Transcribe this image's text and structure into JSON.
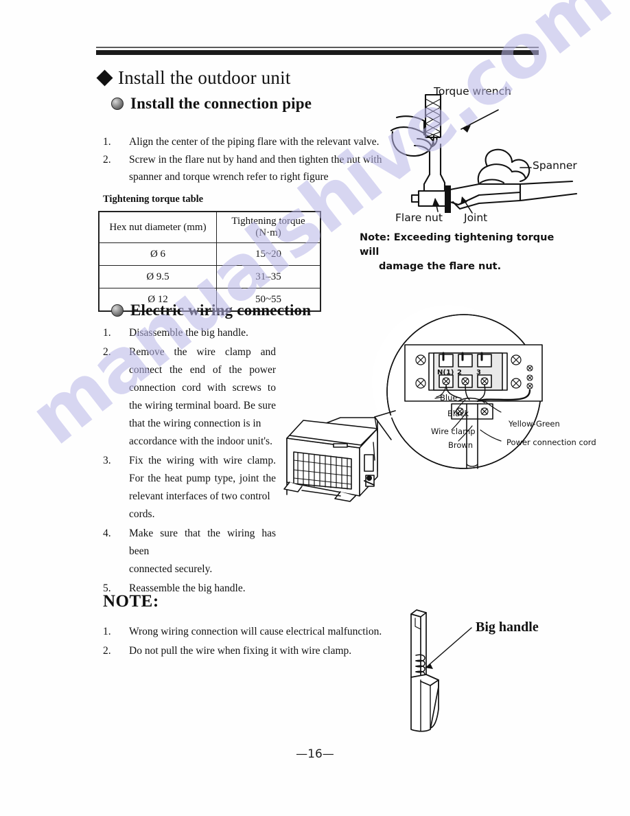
{
  "document": {
    "page_number": "—16—",
    "watermark": "manualshive.com"
  },
  "section_heading": "Install the outdoor unit",
  "subsection_pipe": {
    "title": "Install the connection pipe",
    "steps": [
      {
        "num": "1.",
        "text": "Align the center of the piping flare with the relevant valve."
      },
      {
        "num": "2.",
        "text": "Screw in the flare nut by hand and then tighten the nut with",
        "text2": "spanner and torque wrench refer to right figure"
      }
    ]
  },
  "torque_table": {
    "caption": "Tightening torque table",
    "headers": [
      "Hex nut diameter (mm)",
      "Tightening torque (N·m)"
    ],
    "rows": [
      [
        "Ø 6",
        "15~20"
      ],
      [
        "Ø 9.5",
        "31–35"
      ],
      [
        "Ø 12",
        "50~55"
      ]
    ]
  },
  "subsection_wiring": {
    "title": "Electric wiring connection",
    "steps": [
      {
        "num": "1.",
        "text": "Disassemble the big handle."
      },
      {
        "num": "2.",
        "text": "Remove the wire clamp and connect the end of the power connection cord with screws to the wiring terminal board. Be sure that the wiring connection is in",
        "tail": "accordance with the indoor unit's."
      },
      {
        "num": "3.",
        "text": "Fix the wiring with wire clamp. For the heat pump type, joint the relevant interfaces of two control",
        "tail": "cords."
      },
      {
        "num": "4.",
        "text": "Make sure that the wiring has been",
        "tail": "connected securely."
      },
      {
        "num": "5.",
        "text": "Reassemble the big handle."
      }
    ]
  },
  "note_block": {
    "title": "NOTE:",
    "items": [
      {
        "num": "1.",
        "text": "Wrong wiring connection will cause electrical malfunction."
      },
      {
        "num": "2.",
        "text": "Do not pull the wire when fixing it with wire clamp."
      }
    ]
  },
  "figures": {
    "wrench": {
      "labels": {
        "torque_wrench": "Torque wrench",
        "spanner": "Spanner",
        "flare_nut": "Flare nut",
        "joint": "Joint"
      },
      "note_line1": "Note: Exceeding tightening torque will",
      "note_line2": "damage the flare nut."
    },
    "callout": {
      "terminals": [
        "N(1)",
        "2",
        "3"
      ],
      "labels": {
        "blue": "Blue",
        "black": "Black",
        "yellow_green": "Yellow-Green",
        "wire_clamp": "Wire clamp",
        "brown": "Brown",
        "power_cord": "Power connection cord"
      }
    },
    "handle": {
      "label": "Big handle"
    }
  },
  "colors": {
    "ink": "#111111",
    "watermark": "#b9b6e8"
  }
}
